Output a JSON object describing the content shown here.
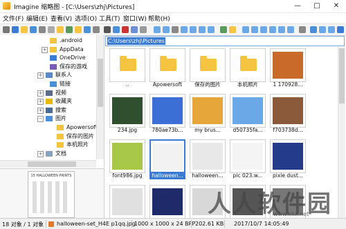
{
  "window": {
    "title": "Imagine 缩略图 - [C:\\Users\\zhj\\Pictures]"
  },
  "menu": [
    "文件(F)",
    "编辑(E)",
    "查看(V)",
    "选项(O)",
    "工具(T)",
    "窗口(W)",
    "帮助(H)"
  ],
  "tree": [
    {
      "label": ".android",
      "icon": "folder",
      "expand": ""
    },
    {
      "label": "AppData",
      "icon": "folder",
      "expand": "+"
    },
    {
      "label": "OneDrive",
      "icon": "onedrive",
      "expand": ""
    },
    {
      "label": "保存的游戏",
      "icon": "games",
      "expand": ""
    },
    {
      "label": "联系人",
      "icon": "contacts",
      "expand": "+"
    },
    {
      "label": "链接",
      "icon": "links",
      "expand": ""
    },
    {
      "label": "视频",
      "icon": "video",
      "expand": "+"
    },
    {
      "label": "收藏夹",
      "icon": "favorites",
      "expand": "+"
    },
    {
      "label": "搜索",
      "icon": "search",
      "expand": "+"
    },
    {
      "label": "图片",
      "icon": "pictures",
      "expand": "-"
    },
    {
      "label": "Apowersoft",
      "icon": "folder",
      "expand": ""
    },
    {
      "label": "保存的图片",
      "icon": "folder",
      "expand": ""
    },
    {
      "label": "本机照片",
      "icon": "folder",
      "expand": ""
    },
    {
      "label": "文档",
      "icon": "documents",
      "expand": "+"
    }
  ],
  "address": {
    "path": "C:\\Users\\zhj\\Pictures"
  },
  "preview": {
    "caption": "15 HALLOWEEN PRINTS"
  },
  "thumbnails": [
    {
      "label": "..",
      "kind": "folder"
    },
    {
      "label": "Apowersoft",
      "kind": "folder"
    },
    {
      "label": "保存的图片",
      "kind": "folder"
    },
    {
      "label": "本机照片",
      "kind": "folder"
    },
    {
      "label": "1 170928...",
      "kind": "photo",
      "color": "#c86a2a"
    },
    {
      "label": "234.jpg",
      "kind": "photo",
      "color": "#2f4f2f"
    },
    {
      "label": "780ae73b...",
      "kind": "photo",
      "color": "#3b6fd6"
    },
    {
      "label": "my brus...",
      "kind": "photo",
      "color": "#e6a63a"
    },
    {
      "label": "d50735fa...",
      "kind": "photo",
      "color": "#6aa8e8"
    },
    {
      "label": "f703738d...",
      "kind": "photo",
      "color": "#8a5a3a"
    },
    {
      "label": "font986.jpg",
      "kind": "photo",
      "color": "#a8c84a"
    },
    {
      "label": "halloween...",
      "kind": "photo",
      "color": "#f2f2f2",
      "selected": true
    },
    {
      "label": "halloween...",
      "kind": "photo",
      "color": "#e8e8e8"
    },
    {
      "label": "pic 023.w...",
      "kind": "photo",
      "color": "#f4f4f4"
    },
    {
      "label": "pixie dust...",
      "kind": "photo",
      "color": "#243a8a"
    },
    {
      "label": "",
      "kind": "photo",
      "color": "#e0e0e0"
    },
    {
      "label": "",
      "kind": "photo",
      "color": "#1e2a6a"
    },
    {
      "label": "",
      "kind": "photo",
      "color": "#d8d8d8"
    },
    {
      "label": "",
      "kind": "photo",
      "color": "#555555"
    },
    {
      "label": "",
      "kind": "photo",
      "color": "#777777"
    }
  ],
  "status": {
    "count": "18 对象 / 1 对象",
    "file": "halloween-set_H4E p1qq.jpg",
    "dims": "1000 x 1000 x 24 BPP",
    "size": "202.61 KB",
    "date": "2017/10/7 14:05:49"
  },
  "watermark": {
    "text": "人人软件园",
    "url": "www.kkx.net"
  },
  "colors": {
    "accent": "#3a7bd5",
    "folder": "#f5c542"
  }
}
